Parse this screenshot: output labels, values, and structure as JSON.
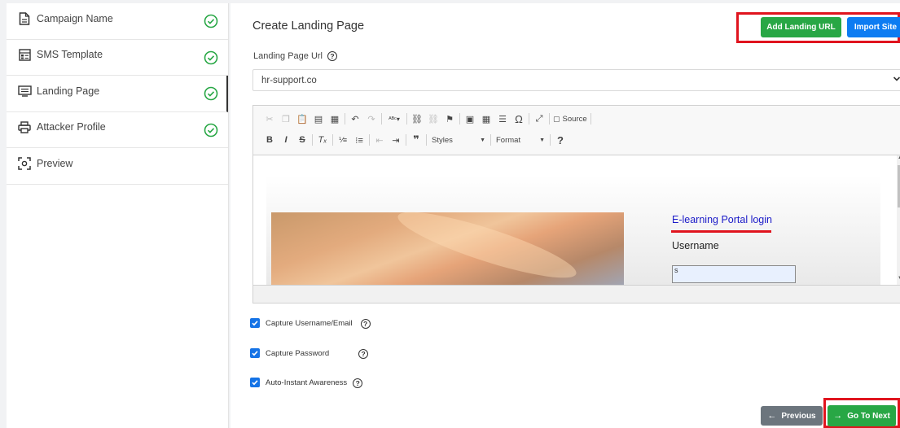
{
  "sidebar": {
    "items": [
      {
        "label": "Campaign Name",
        "icon": "document-icon",
        "completed": true
      },
      {
        "label": "SMS Template",
        "icon": "template-icon",
        "completed": true
      },
      {
        "label": "Landing Page",
        "icon": "landing-page-icon",
        "completed": true,
        "active": true
      },
      {
        "label": "Attacker Profile",
        "icon": "printer-icon",
        "completed": true
      },
      {
        "label": "Preview",
        "icon": "scan-icon",
        "completed": false
      }
    ]
  },
  "main": {
    "title": "Create Landing Page",
    "add_landing_url": "Add Landing URL",
    "import_site": "Import Site",
    "url_label": "Landing Page Url",
    "url_value": "hr-support.co"
  },
  "editor": {
    "source_label": "Source",
    "styles_label": "Styles",
    "format_label": "Format",
    "content": {
      "login_title": "E-learning Portal login",
      "username_label": "Username",
      "username_value": "s"
    }
  },
  "options": [
    {
      "label": "Capture Username/Email",
      "checked": true
    },
    {
      "label": "Capture Password",
      "checked": true
    },
    {
      "label": "Auto-Instant Awareness",
      "checked": true
    }
  ],
  "footer": {
    "previous": "Previous",
    "next": "Go To Next"
  },
  "colors": {
    "success": "#28a745",
    "primary": "#0d7cf2",
    "secondary": "#6c757d",
    "highlight": "#e0141e",
    "checkbox": "#1573e6"
  }
}
